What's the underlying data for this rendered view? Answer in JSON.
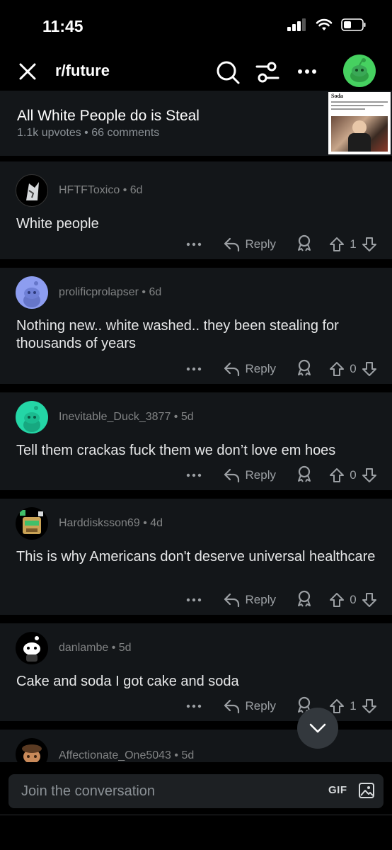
{
  "status_bar": {
    "time": "11:45"
  },
  "top_bar": {
    "subreddit": "r/future"
  },
  "post": {
    "title": "All White People do is Steal",
    "meta": "1.1k upvotes • 66 comments",
    "thumbnail_caption": "Soda"
  },
  "comments": [
    {
      "username": "HFTFToxico",
      "age": "6d",
      "body": "White people",
      "reply_label": "Reply",
      "votes": "1"
    },
    {
      "username": "prolificprolapser",
      "age": "6d",
      "body": "Nothing new.. white washed.. they been stealing for thousands of years",
      "reply_label": "Reply",
      "votes": "0"
    },
    {
      "username": "Inevitable_Duck_3877",
      "age": "5d",
      "body": "Tell them crackas fuck them we don’t love em hoes",
      "reply_label": "Reply",
      "votes": "0"
    },
    {
      "username": "Harddisksson69",
      "age": "4d",
      "body": "This is why Americans don't deserve universal healthcare",
      "reply_label": "Reply",
      "votes": "0"
    },
    {
      "username": "danlambe",
      "age": "5d",
      "body": "Cake and soda I got cake and soda",
      "reply_label": "Reply",
      "votes": "1"
    },
    {
      "username": "Affectionate_One5043",
      "age": "5d"
    }
  ],
  "composer": {
    "placeholder": "Join the conversation",
    "gif_label": "GIF"
  },
  "icons": {
    "close": "close-icon",
    "search": "search-icon",
    "filter": "filter-icon",
    "more": "more-icon",
    "reply": "reply-arrow-icon",
    "award": "award-icon",
    "upvote": "upvote-icon",
    "downvote": "downvote-icon",
    "chevron_down": "chevron-down-icon",
    "image": "image-icon"
  },
  "colors": {
    "accent_green": "#46d160",
    "background": "#000000",
    "card": "#131619",
    "muted_text": "#818384"
  }
}
